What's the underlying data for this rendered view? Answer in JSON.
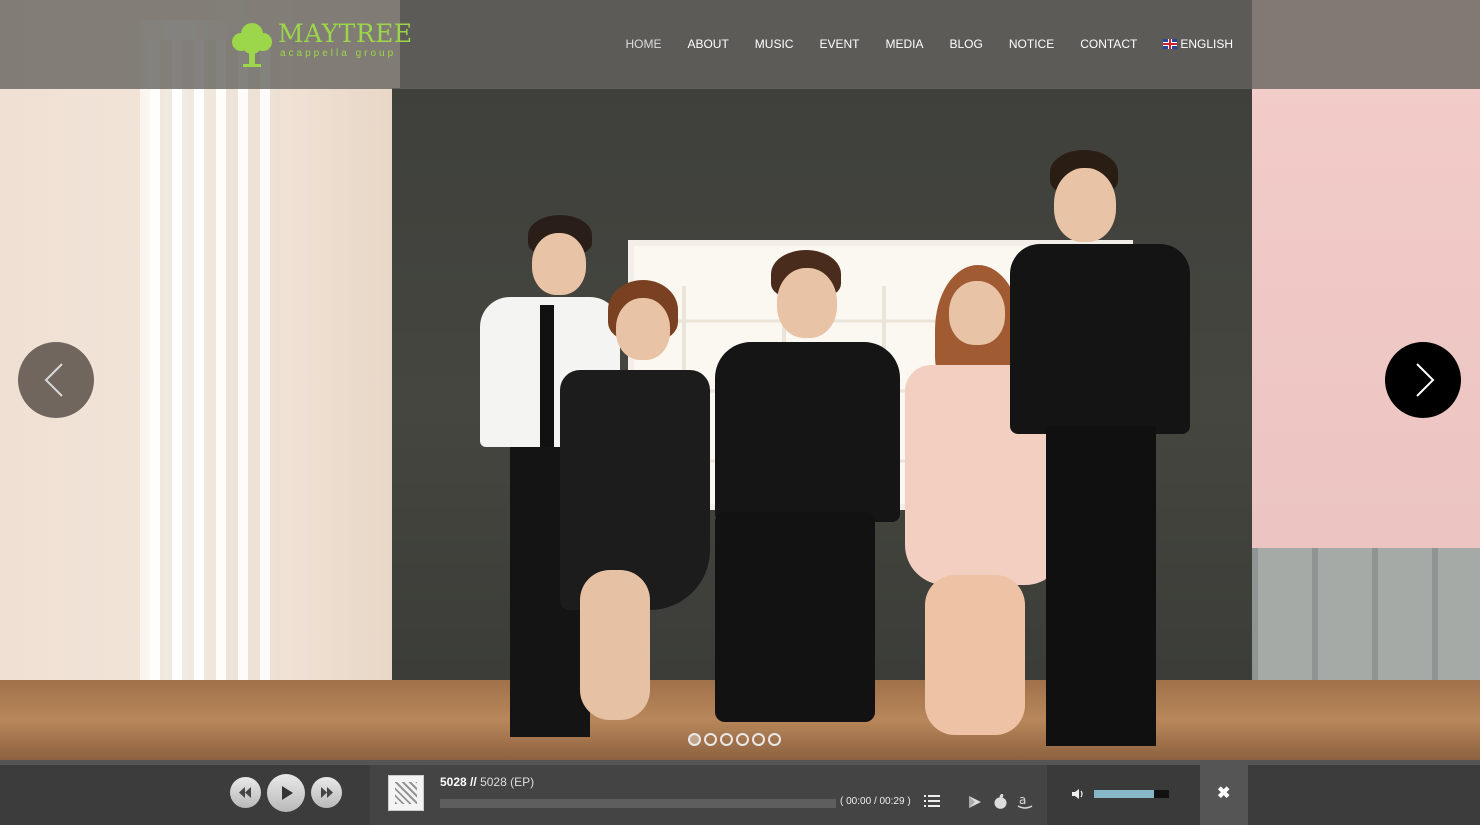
{
  "header": {
    "logo": {
      "title": "MAYTREE",
      "subtitle": "acappella group",
      "icon": "tree-icon",
      "color": "#9cd64a"
    },
    "nav": [
      {
        "label": "HOME",
        "active": true
      },
      {
        "label": "ABOUT",
        "active": false
      },
      {
        "label": "MUSIC",
        "active": false
      },
      {
        "label": "EVENT",
        "active": false
      },
      {
        "label": "MEDIA",
        "active": false
      },
      {
        "label": "BLOG",
        "active": false
      },
      {
        "label": "NOTICE",
        "active": false
      },
      {
        "label": "CONTACT",
        "active": false
      }
    ],
    "language": {
      "label": "ENGLISH",
      "icon": "uk-flag-icon"
    }
  },
  "slider": {
    "prev_icon": "chevron-left-icon",
    "next_icon": "chevron-right-icon",
    "dot_count": 6,
    "active_index": 0
  },
  "player": {
    "track_number": "5028",
    "separator": "//",
    "album": "5028 (EP)",
    "time_current": "00:00",
    "time_total": "00:29",
    "progress": 0,
    "volume": 0.8,
    "icons": [
      "rewind-icon",
      "play-icon",
      "fast-forward-icon",
      "playlist-icon",
      "google-play-icon",
      "apple-icon",
      "amazon-icon",
      "volume-icon",
      "close-icon"
    ]
  },
  "colors": {
    "accent": "#9cd64a",
    "player_bg": "#3c3c3c",
    "volume_fill": "#86b8c7"
  }
}
